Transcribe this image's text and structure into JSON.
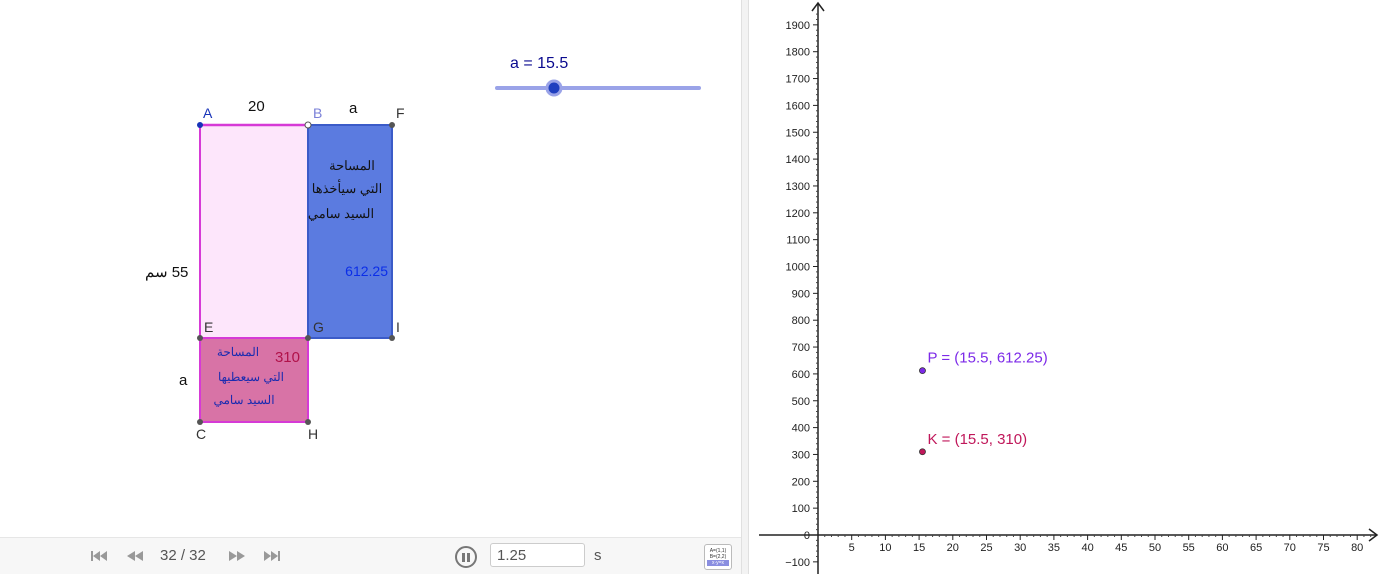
{
  "slider": {
    "label": "a = 15.5",
    "value": 15.5,
    "min": 0,
    "max": 40,
    "fraction": 0.3875
  },
  "rects": {
    "top_width_label": "20",
    "top_right_label": "a",
    "left_height_label": "55 سم",
    "bottom_left_label": "a",
    "blue_area_value": "612.25",
    "pink_area_value": "310",
    "blue_text_lines": [
      "المساحة",
      "التي سيأخذها",
      "السيد سامي"
    ],
    "pink_text_lines": [
      "المساحة",
      "التي سيعطيها",
      "السيد سامي"
    ],
    "points": {
      "A": "A",
      "B": "B",
      "F": "F",
      "E": "E",
      "G": "G",
      "I": "I",
      "C": "C",
      "H": "H"
    }
  },
  "toolbar": {
    "frame_counter": "32 / 32",
    "speed_value": "1.25",
    "speed_unit": "s",
    "algebra_icon_lines": [
      "A=(1,1)",
      "B=(2,2)",
      "x·y=x"
    ]
  },
  "graph": {
    "x_ticks": [
      "5",
      "10",
      "15",
      "20",
      "25",
      "30",
      "35",
      "40",
      "45",
      "50",
      "55",
      "60",
      "65",
      "70",
      "75",
      "80"
    ],
    "y_ticks": [
      "1900",
      "1800",
      "1700",
      "1600",
      "1500",
      "1400",
      "1300",
      "1200",
      "1100",
      "1000",
      "900",
      "800",
      "700",
      "600",
      "500",
      "400",
      "300",
      "200",
      "100",
      "0",
      "−100"
    ],
    "points": [
      {
        "label": "P = (15.5, 612.25)",
        "x": 15.5,
        "y": 612.25,
        "color": "#7c2ae8"
      },
      {
        "label": "K = (15.5, 310)",
        "x": 15.5,
        "y": 310,
        "color": "#c0175a"
      }
    ]
  },
  "colors": {
    "pink_rect": "#fce4fb",
    "blue_rect": "#5b7be0",
    "magenta": "#d63ad6",
    "slider_blue": "#1f3fbf"
  }
}
